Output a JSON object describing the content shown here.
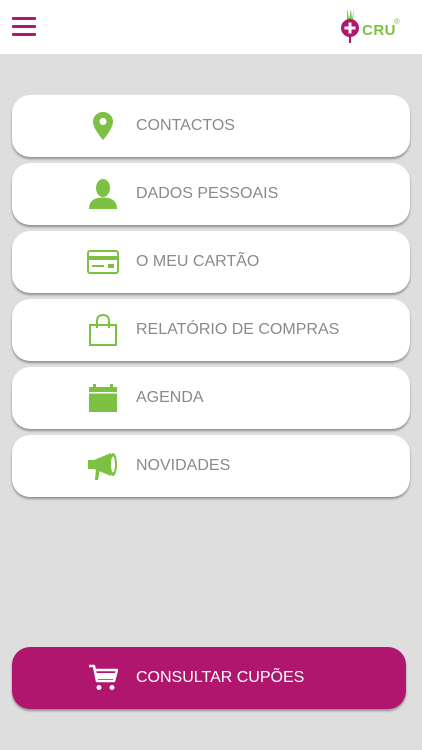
{
  "header": {
    "logo_text": "CRU",
    "logo_reg": "®"
  },
  "menu": {
    "items": [
      {
        "label": "CONTACTOS",
        "icon": "location-pin-icon"
      },
      {
        "label": "DADOS PESSOAIS",
        "icon": "person-icon"
      },
      {
        "label": "O MEU CARTÃO",
        "icon": "card-icon"
      },
      {
        "label": "RELATÓRIO DE COMPRAS",
        "icon": "shopping-bag-icon"
      },
      {
        "label": "AGENDA",
        "icon": "calendar-icon"
      },
      {
        "label": "NOVIDADES",
        "icon": "megaphone-icon"
      }
    ]
  },
  "coupon_button": {
    "label": "CONSULTAR CUPÕES",
    "icon": "shopping-cart-icon"
  },
  "colors": {
    "accent": "#b0166e",
    "icon_green": "#7dc142",
    "label_gray": "#8a8a8a",
    "background": "#dedede"
  }
}
